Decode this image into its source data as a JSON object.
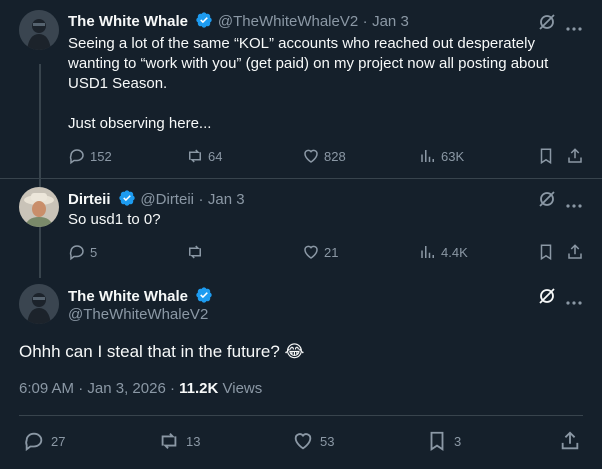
{
  "tweets": [
    {
      "name": "The White Whale",
      "handle": "@TheWhiteWhaleV2",
      "date": "Jan 3",
      "text": "Seeing a lot of the same “KOL” accounts who reached out desperately wanting to “work with you” (get paid) on my project now all posting about USD1 Season.\n\nJust observing here...",
      "replies": "152",
      "reposts": "64",
      "likes": "828",
      "views": "63K"
    },
    {
      "name": "Dirteii",
      "handle": "@Dirteii",
      "date": "Jan 3",
      "text": "So usd1 to 0?",
      "replies": "5",
      "reposts": "",
      "likes": "21",
      "views": "4.4K"
    }
  ],
  "main": {
    "name": "The White Whale",
    "handle": "@TheWhiteWhaleV2",
    "text": "Ohhh can I steal that in the future? 😂",
    "time": "6:09 AM",
    "date": "Jan 3, 2026",
    "views_count": "11.2K",
    "views_label": "Views",
    "replies": "27",
    "reposts": "13",
    "likes": "53",
    "bookmarks": "3"
  },
  "separator": "·",
  "colors": {
    "background": "#15202b",
    "muted": "#8b98a5",
    "verified": "#1d9bf0",
    "divider": "#38444d"
  },
  "icons": [
    "verified-badge-icon",
    "grok-icon",
    "more-icon",
    "reply-icon",
    "repost-icon",
    "like-icon",
    "views-icon",
    "bookmark-icon",
    "share-icon"
  ]
}
